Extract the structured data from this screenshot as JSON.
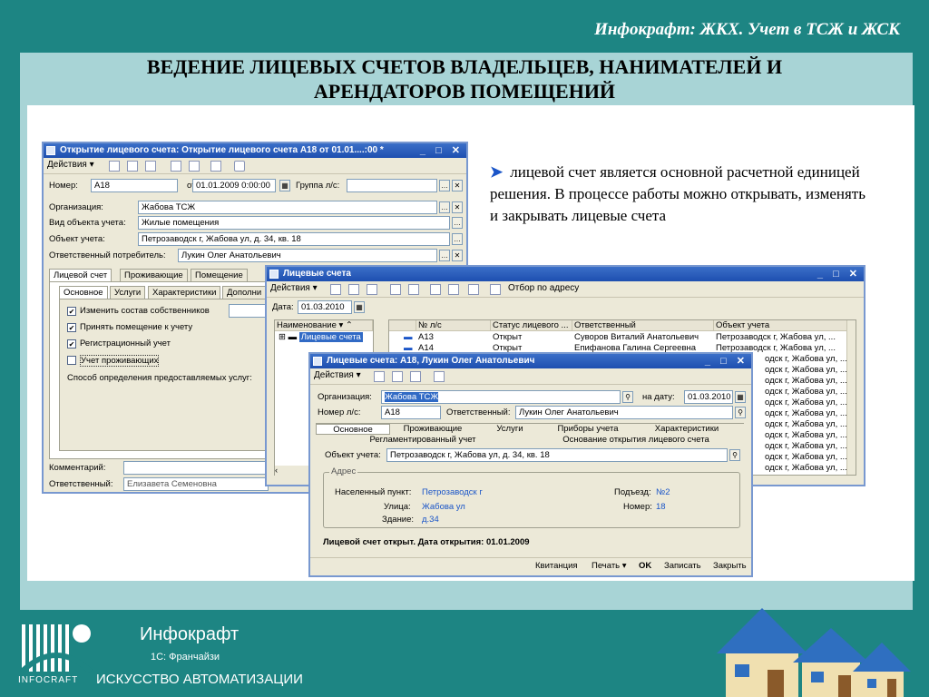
{
  "header": {
    "title": "Инфокрафт: ЖКХ. Учет в ТСЖ и ЖСК"
  },
  "slide": {
    "title_line1": "ВЕДЕНИЕ ЛИЦЕВЫХ СЧЕТОВ ВЛАДЕЛЬЦЕВ, НАНИМАТЕЛЕЙ И",
    "title_line2": "АРЕНДАТОРОВ ПОМЕЩЕНИЙ",
    "bullet": "лицевой счет является основной расчетной единицей решения. В процессе работы можно открывать, изменять и закрывать лицевые счета"
  },
  "win_open": {
    "title": "Открытие лицевого счета: Открытие лицевого счета А18 от 01.01....:00 *",
    "actions": "Действия ▾",
    "number_label": "Номер:",
    "number": "А18",
    "from_label": "от:",
    "date": "01.01.2009  0:00:00",
    "group_label": "Группа л/с:",
    "org_label": "Организация:",
    "org": "Жабова ТСЖ",
    "objtype_label": "Вид объекта учета:",
    "objtype": "Жилые помещения",
    "obj_label": "Объект учета:",
    "obj": "Петрозаводск г, Жабова ул, д. 34, кв. 18",
    "consumer_label": "Ответственный потребитель:",
    "consumer": "Лукин Олег Анатольевич",
    "tabs": [
      "Лицевой счет",
      "Проживающие",
      "Помещение"
    ],
    "subtabs": [
      "Основное",
      "Услуги",
      "Характеристики",
      "Дополни"
    ],
    "checks": [
      {
        "label": "Изменить состав собственников",
        "checked": true
      },
      {
        "label": "Принять помещение к учету",
        "checked": true
      },
      {
        "label": "Регистрационный учет",
        "checked": true
      },
      {
        "label": "Учет проживающих",
        "checked": false
      }
    ],
    "method_label": "Способ определения предоставляемых услуг:",
    "comment_label": "Комментарий:",
    "resp_label": "Ответственный:",
    "resp": "Елизавета Семеновна"
  },
  "win_list": {
    "title": "Лицевые счета",
    "actions": "Действия ▾",
    "filter_label": "Отбор по адресу",
    "date_label": "Дата:",
    "date": "01.03.2010",
    "tree_header": "Наименование",
    "tree_item": "Лицевые счета",
    "columns": [
      "№ л/с",
      "Статус лицевого ...",
      "Ответственный",
      "Объект учета"
    ],
    "rows": [
      {
        "num": "А13",
        "status": "Открыт",
        "resp": "Суворов Виталий Анатольевич",
        "obj": "Петрозаводск г, Жабова ул, ..."
      },
      {
        "num": "А14",
        "status": "Открыт",
        "resp": "Епифанова Галина Сергеевна",
        "obj": "Петрозаводск г, Жабова ул, ..."
      }
    ],
    "obj_tail": "одск г, Жабова ул, ..."
  },
  "win_account": {
    "title": "Лицевые счета: А18, Лукин Олег Анатольевич",
    "actions": "Действия ▾",
    "org_label": "Организация:",
    "org": "Жабова ТСЖ",
    "ondate_label": "на дату:",
    "ondate": "01.03.2010",
    "num_label": "Номер л/с:",
    "num": "А18",
    "resp_label": "Ответственный:",
    "resp": "Лукин Олег Анатольевич",
    "tabs_row1": [
      "Основное",
      "Проживающие",
      "Услуги",
      "Приборы учета",
      "Характеристики"
    ],
    "tabs_row2": [
      "Регламентированный учет",
      "Основание открытия лицевого счета"
    ],
    "obj_label": "Объект учета:",
    "obj": "Петрозаводск г, Жабова ул, д. 34, кв. 18",
    "address_group": "Адрес",
    "city_label": "Населенный пункт:",
    "city": "Петрозаводск г",
    "entrance_label": "Подъезд:",
    "entrance": "№2",
    "street_label": "Улица:",
    "street": "Жабова ул",
    "flat_label": "Номер:",
    "flat": "18",
    "building_label": "Здание:",
    "building": "д.34",
    "status_text": "Лицевой счет открыт. Дата открытия: 01.01.2009",
    "bottom_buttons": [
      "Квитанция",
      "Печать ▾",
      "OK",
      "Записать",
      "Закрыть"
    ]
  },
  "footer": {
    "brand": "Инфокрафт",
    "sub1": "1С: Франчайзи",
    "sub2": "ИСКУССТВО АВТОМАТИЗАЦИИ",
    "logo_caption": "INFOCRAFT"
  }
}
